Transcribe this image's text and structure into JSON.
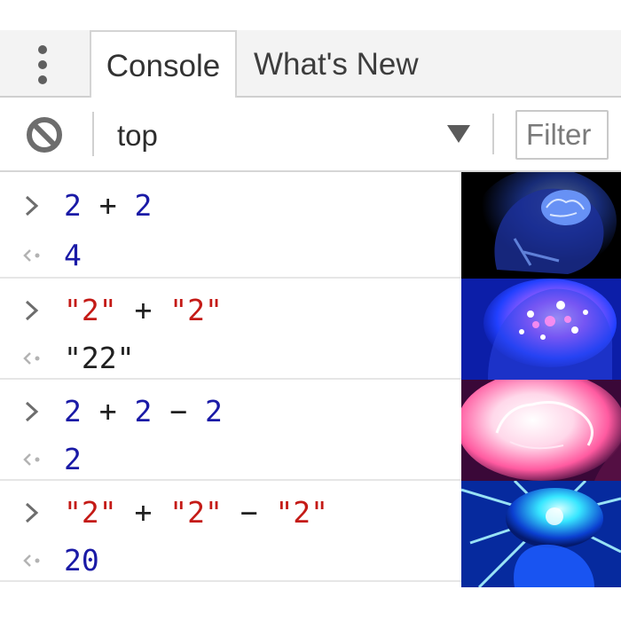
{
  "tabs": {
    "menu_icon": "kebab-menu-icon",
    "console": "Console",
    "whats_new": "What's New"
  },
  "toolbar": {
    "clear_icon": "block-icon",
    "context": "top",
    "dropdown_icon": "triangle-down-icon",
    "filter_placeholder": "Filter"
  },
  "console": [
    {
      "input": [
        {
          "t": "2",
          "k": "num"
        },
        {
          "t": " + ",
          "k": "op"
        },
        {
          "t": "2",
          "k": "num"
        }
      ],
      "output": [
        {
          "t": "4",
          "k": "num"
        }
      ]
    },
    {
      "input": [
        {
          "t": "\"2\"",
          "k": "str"
        },
        {
          "t": " + ",
          "k": "op"
        },
        {
          "t": "\"2\"",
          "k": "str"
        }
      ],
      "output": [
        {
          "t": "\"22\"",
          "k": "op"
        }
      ]
    },
    {
      "input": [
        {
          "t": "2",
          "k": "num"
        },
        {
          "t": " + ",
          "k": "op"
        },
        {
          "t": "2",
          "k": "num"
        },
        {
          "t": " − ",
          "k": "op"
        },
        {
          "t": "2",
          "k": "num"
        }
      ],
      "output": [
        {
          "t": "2",
          "k": "num"
        }
      ]
    },
    {
      "input": [
        {
          "t": "\"2\"",
          "k": "str"
        },
        {
          "t": " + ",
          "k": "op"
        },
        {
          "t": "\"2\"",
          "k": "str"
        },
        {
          "t": " − ",
          "k": "op"
        },
        {
          "t": "\"2\"",
          "k": "str"
        }
      ],
      "output": [
        {
          "t": "20",
          "k": "num"
        }
      ]
    }
  ],
  "colors": {
    "number": "#1a1aa6",
    "string": "#c41a16",
    "operator": "#202020",
    "brain_glow_1": "#3a6bff",
    "brain_glow_2": "#ff7de0",
    "brain_glow_3": "#ffffff",
    "brain_glow_4": "#37e6ff"
  },
  "brain_images": [
    "small-brain-image",
    "glowing-brain-image",
    "radiant-brain-image",
    "galaxy-brain-image"
  ]
}
